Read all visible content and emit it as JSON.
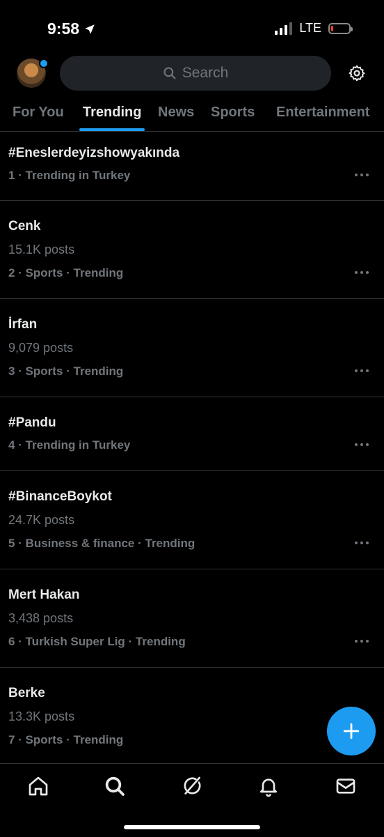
{
  "status": {
    "time": "9:58",
    "network": "LTE",
    "battery_percent": 10,
    "signal_bars": 3
  },
  "header": {
    "search_placeholder": "Search"
  },
  "tabs": [
    {
      "label": "For You"
    },
    {
      "label": "Trending"
    },
    {
      "label": "News"
    },
    {
      "label": "Sports"
    },
    {
      "label": "Entertainment"
    }
  ],
  "active_tab": "Trending",
  "trends": [
    {
      "title": "#Eneslerdeyizshowyakında",
      "posts": "",
      "meta": "1 · Trending in Turkey"
    },
    {
      "title": "Cenk",
      "posts": "15.1K posts",
      "meta": "2 · Sports · Trending"
    },
    {
      "title": "İrfan",
      "posts": "9,079 posts",
      "meta": "3 · Sports · Trending"
    },
    {
      "title": "#Pandu",
      "posts": "",
      "meta": "4 · Trending in Turkey"
    },
    {
      "title": "#BinanceBoykot",
      "posts": "24.7K posts",
      "meta": "5 · Business & finance · Trending"
    },
    {
      "title": "Mert Hakan",
      "posts": "3,438 posts",
      "meta": "6 · Turkish Super Lig · Trending"
    },
    {
      "title": "Berke",
      "posts": "13.3K posts",
      "meta": "7 · Sports · Trending"
    }
  ],
  "colors": {
    "accent": "#1d9bf0",
    "background": "#000000",
    "secondary_text": "#71767b",
    "divider": "#2f3336"
  },
  "icons": {
    "bottom_nav": [
      "home-icon",
      "search-icon",
      "grok-icon",
      "notifications-icon",
      "messages-icon"
    ],
    "fab": "plus-icon",
    "header": [
      "avatar",
      "search-icon",
      "gear-icon"
    ]
  }
}
